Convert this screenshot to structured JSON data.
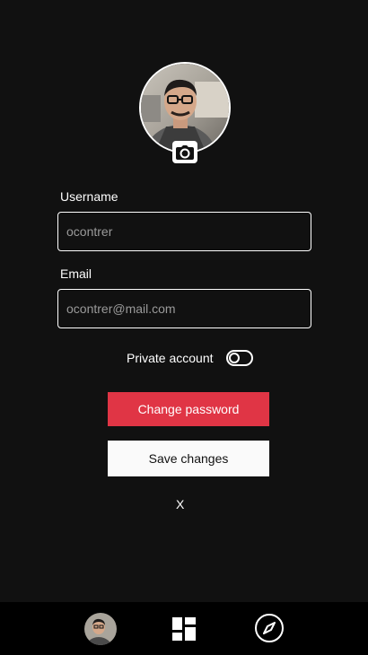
{
  "profile": {
    "avatar_icon": "profile-photo",
    "change_photo_icon": "camera-icon"
  },
  "form": {
    "username": {
      "label": "Username",
      "value": "ocontrer"
    },
    "email": {
      "label": "Email",
      "value": "ocontrer@mail.com"
    },
    "private_account": {
      "label": "Private account",
      "enabled": false
    }
  },
  "actions": {
    "change_password_label": "Change password",
    "save_changes_label": "Save changes",
    "close_label": "X"
  },
  "nav": {
    "items": [
      {
        "icon": "profile-avatar-icon"
      },
      {
        "icon": "dashboard-grid-icon"
      },
      {
        "icon": "compass-icon"
      }
    ]
  },
  "colors": {
    "background": "#111111",
    "nav_background": "#000000",
    "danger": "#e03545",
    "light_button": "#fafafa",
    "text": "#ffffff",
    "input_text": "#9a9a9a"
  }
}
